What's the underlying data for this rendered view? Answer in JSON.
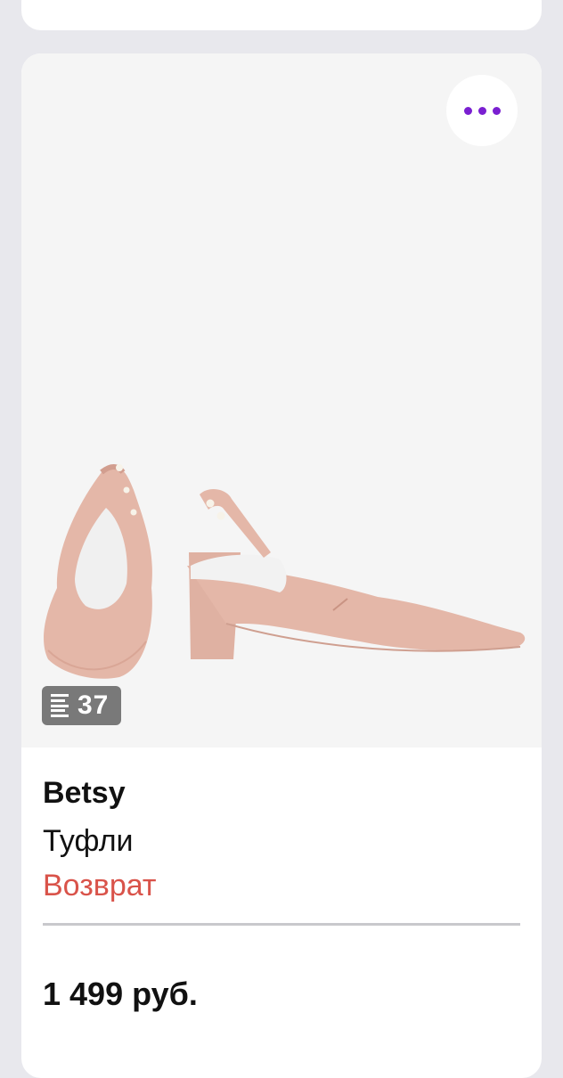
{
  "product": {
    "brand": "Betsy",
    "category": "Туфли",
    "status": "Возврат",
    "price": "1 499 руб.",
    "size": "37",
    "status_color": "#d9534a"
  },
  "icons": {
    "more": "more-horizontal-icon",
    "size": "size-lines-icon"
  },
  "colors": {
    "accent": "#7a1fd1",
    "shoe": "#e4b7a8"
  }
}
